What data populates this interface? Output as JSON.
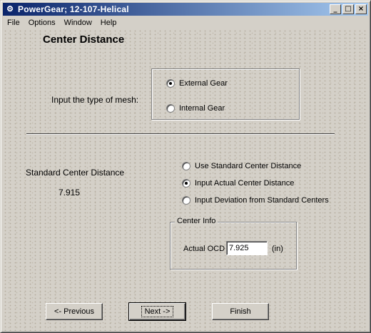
{
  "window": {
    "title": "PowerGear;  12-107-Helical",
    "minimize": "_",
    "maximize": "□",
    "close": "×"
  },
  "menu": [
    "File",
    "Options",
    "Window",
    "Help"
  ],
  "page": {
    "title": "Center Distance"
  },
  "mesh": {
    "label": "Input the type of mesh:",
    "options": [
      {
        "label": "External Gear",
        "selected": true
      },
      {
        "label": "Internal Gear",
        "selected": false
      }
    ]
  },
  "standard": {
    "label": "Standard Center Distance",
    "value": "7.915"
  },
  "center_mode": {
    "options": [
      {
        "label": "Use Standard Center Distance",
        "selected": false
      },
      {
        "label": "Input Actual Center Distance",
        "selected": true
      },
      {
        "label": "Input Deviation from Standard Centers",
        "selected": false
      }
    ]
  },
  "center_info": {
    "title": "Center Info",
    "ocd_label": "Actual OCD",
    "ocd_value": "7.925",
    "unit": "(in)"
  },
  "buttons": {
    "previous": "<- Previous",
    "next": "Next ->",
    "finish": "Finish"
  },
  "colors": {
    "face": "#d4d0c8",
    "title_start": "#0a246a",
    "title_end": "#a6caf0"
  }
}
